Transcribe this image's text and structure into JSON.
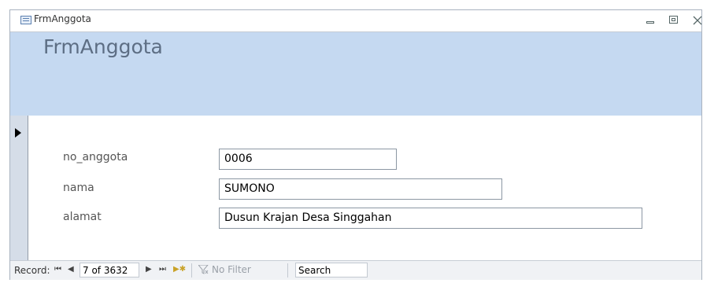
{
  "window": {
    "title": "FrmAnggota"
  },
  "form": {
    "header_title": "FrmAnggota"
  },
  "fields": [
    {
      "label": "no_anggota",
      "value": "0006"
    },
    {
      "label": "nama",
      "value": "SUMONO"
    },
    {
      "label": "alamat",
      "value": "Dusun Krajan Desa Singgahan"
    }
  ],
  "navigation": {
    "record_label": "Record:",
    "first": "⏮",
    "prev": "◀",
    "current": "7 of 3632",
    "next": "▶",
    "last": "⏭",
    "new": "▶✱",
    "filter_label": "No Filter",
    "search_placeholder": "Search"
  },
  "colors": {
    "header_bg": "#c5d9f1",
    "title_text": "#5d6e84"
  }
}
